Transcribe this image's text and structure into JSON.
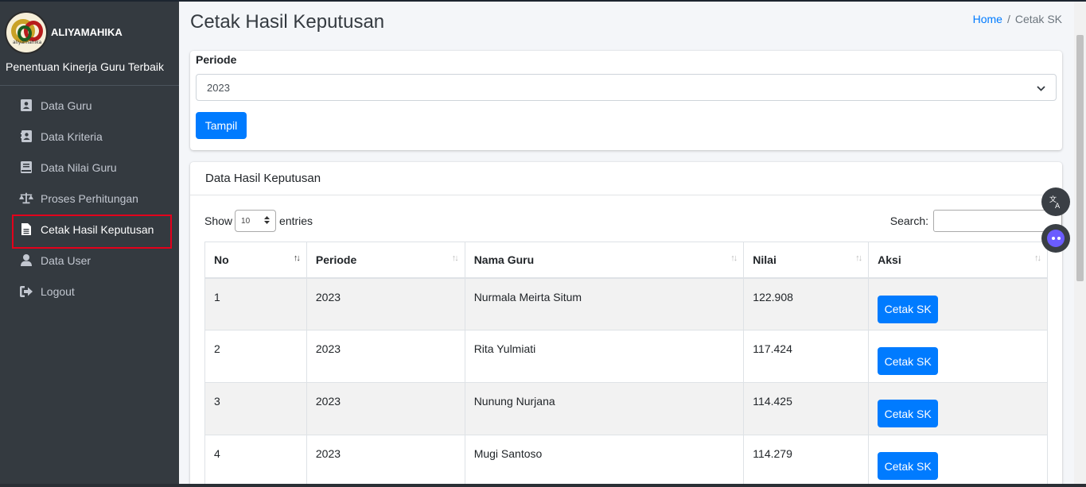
{
  "brand": {
    "name": "ALIYAMAHIKA",
    "logo_text": "aliyamahika",
    "subtitle": "Penentuan Kinerja Guru Terbaik"
  },
  "sidebar": {
    "items": [
      {
        "label": "Data Guru",
        "icon": "address-card-icon"
      },
      {
        "label": "Data Kriteria",
        "icon": "address-book-icon"
      },
      {
        "label": "Data Nilai Guru",
        "icon": "book-icon"
      },
      {
        "label": "Proses Perhitungan",
        "icon": "balance-scale-icon"
      },
      {
        "label": "Cetak Hasil Keputusan",
        "icon": "file-alt-icon",
        "active": true
      },
      {
        "label": "Data User",
        "icon": "user-icon"
      },
      {
        "label": "Logout",
        "icon": "sign-out-icon"
      }
    ]
  },
  "header": {
    "title": "Cetak Hasil Keputusan",
    "breadcrumb": {
      "home": "Home",
      "separator": "/",
      "current": "Cetak SK"
    }
  },
  "filter": {
    "label": "Periode",
    "selected": "2023",
    "button": "Tampil"
  },
  "results": {
    "title": "Data Hasil Keputusan",
    "show_label": "Show",
    "entries_value": "10",
    "entries_label": "entries",
    "search_label": "Search:",
    "columns": [
      "No",
      "Periode",
      "Nama Guru",
      "Nilai",
      "Aksi"
    ],
    "rows": [
      {
        "no": "1",
        "periode": "2023",
        "nama": "Nurmala Meirta Situm",
        "nilai": "122.908",
        "aksi": "Cetak SK"
      },
      {
        "no": "2",
        "periode": "2023",
        "nama": "Rita Yulmiati",
        "nilai": "117.424",
        "aksi": "Cetak SK"
      },
      {
        "no": "3",
        "periode": "2023",
        "nama": "Nunung Nurjana",
        "nilai": "114.425",
        "aksi": "Cetak SK"
      },
      {
        "no": "4",
        "periode": "2023",
        "nama": "Mugi Santoso",
        "nilai": "114.279",
        "aksi": "Cetak SK"
      }
    ]
  },
  "colors": {
    "sidebar_bg": "#343a40",
    "primary": "#007bff",
    "highlight": "#e3001b"
  }
}
